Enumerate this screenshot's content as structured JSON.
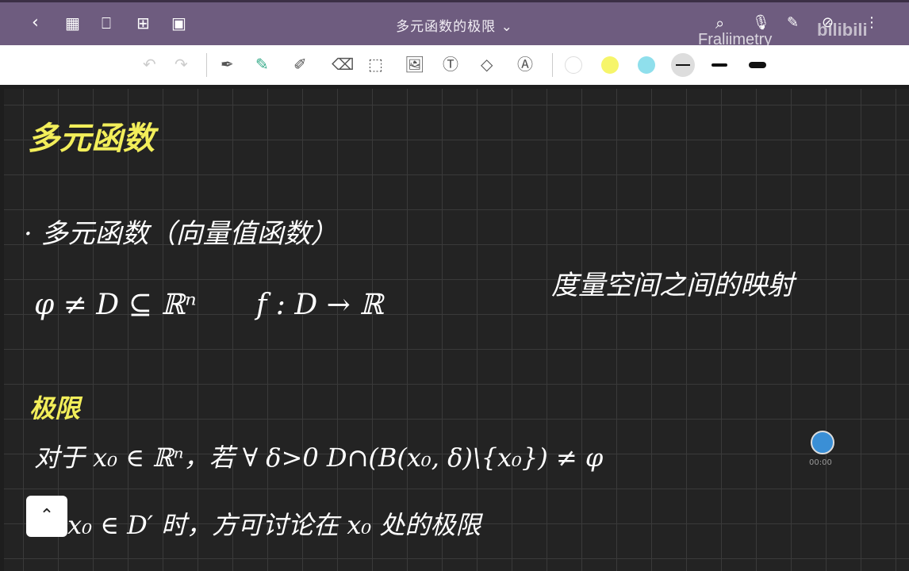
{
  "header": {
    "title": "多元函数的极限",
    "title_chevron": "⌄",
    "watermark": "Fraliimetry",
    "watermark_logo": "bilibili"
  },
  "colors": {
    "header": "#6e5c7f",
    "highlight": "#f2ee5a",
    "canvas": "#232323"
  },
  "notes": {
    "heading1": "多元函数",
    "line1": "· 多元函数（向量值函数）",
    "line2": "φ ≠ D ⊆ ℝⁿ",
    "line2b": "f : D → ℝ",
    "side": "度量空间之间的映射",
    "heading2": "极限",
    "line3": "对于 x₀ ∈ ℝⁿ，若 ∀ δ>0   D∩(B(x₀, δ)\\{x₀}) ≠ φ",
    "line4": "即  x₀ ∈ D′ 时，方可讨论在 x₀ 处的极限"
  },
  "recorder": {
    "time": "00:00"
  }
}
